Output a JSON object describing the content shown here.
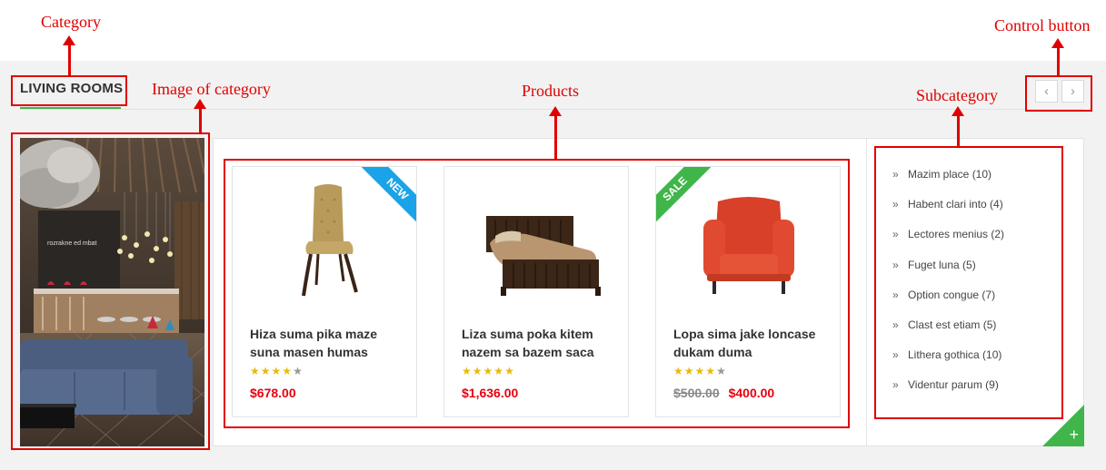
{
  "annotations": {
    "category": "Category",
    "image_of_category": "Image of category",
    "products": "Products",
    "subcategory": "Subcategory",
    "control_button": "Control button"
  },
  "category": {
    "title": "LIVING ROOMS",
    "accent_color": "#3fb54a"
  },
  "controls": {
    "prev_icon": "chevron-left-icon",
    "next_icon": "chevron-right-icon"
  },
  "products": [
    {
      "name_line1": "Hiza suma pika maze",
      "name_line2": "suna masen humas",
      "rating": 4,
      "rating_max": 5,
      "price": "$678.00",
      "old_price": "",
      "badge": "NEW",
      "badge_color": "#1aa3e8"
    },
    {
      "name_line1": "Liza suma poka kitem",
      "name_line2": "nazem sa bazem saca",
      "rating": 5,
      "rating_max": 5,
      "price": "$1,636.00",
      "old_price": "",
      "badge": "",
      "badge_color": ""
    },
    {
      "name_line1": "Lopa sima jake loncase",
      "name_line2": "dukam duma",
      "rating": 4,
      "rating_max": 5,
      "price": "$400.00",
      "old_price": "$500.00",
      "badge": "SALE",
      "badge_color": "#3fb54a"
    }
  ],
  "subcategories": [
    {
      "label": "Mazim place (10)"
    },
    {
      "label": "Habent clari into (4)"
    },
    {
      "label": "Lectores menius (2)"
    },
    {
      "label": "Fuget luna (5)"
    },
    {
      "label": "Option congue (7)"
    },
    {
      "label": "Clast est etiam (5)"
    },
    {
      "label": "Lithera gothica (10)"
    },
    {
      "label": "Videntur parum (9)"
    }
  ],
  "more_icon": "plus-icon"
}
